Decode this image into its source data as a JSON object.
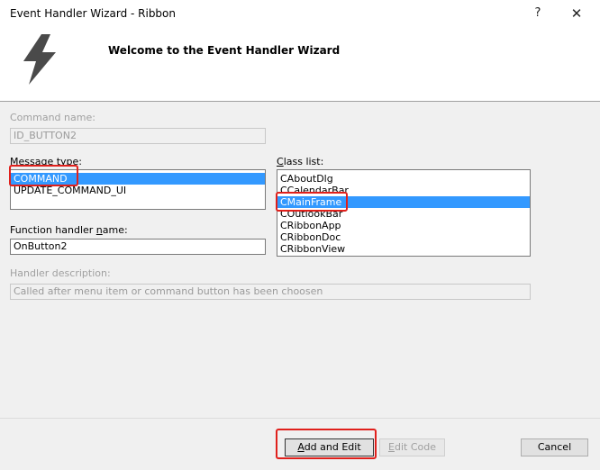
{
  "window": {
    "title": "Event Handler Wizard - Ribbon",
    "help_label": "?",
    "close_label": "✕"
  },
  "header": {
    "title": "Welcome to the Event Handler Wizard"
  },
  "form": {
    "command_name_label": "Command name:",
    "command_name_value": "ID_BUTTON2",
    "message_type_label": "Message type:",
    "message_types": [
      "COMMAND",
      "UPDATE_COMMAND_UI"
    ],
    "class_list_label": "Class list:",
    "classes": [
      "CAboutDlg",
      "CCalendarBar",
      "CMainFrame",
      "COutlookBar",
      "CRibbonApp",
      "CRibbonDoc",
      "CRibbonView"
    ],
    "function_handler_label": "Function handler name:",
    "function_handler_value": "OnButton2",
    "handler_description_label": "Handler description:",
    "handler_description_value": "Called after menu item or command button has been choosen"
  },
  "buttons": {
    "add_and_edit": "Add and Edit",
    "edit_code": "Edit Code",
    "cancel": "Cancel"
  }
}
